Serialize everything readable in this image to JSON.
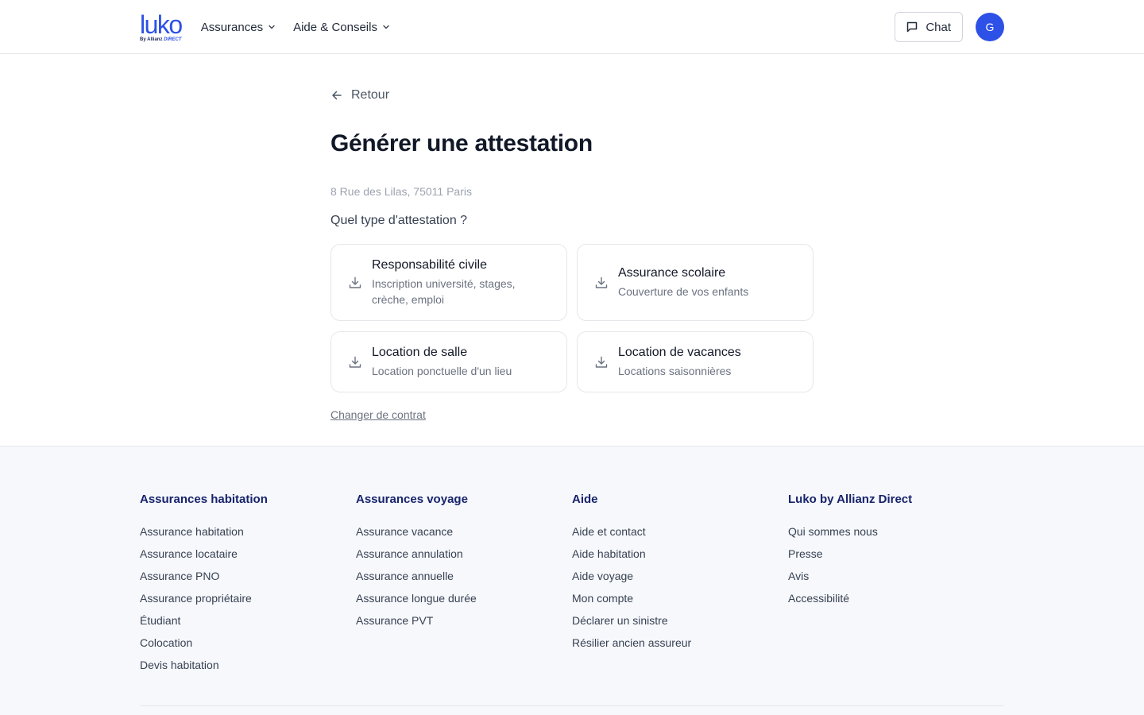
{
  "header": {
    "logo": {
      "word": "luko",
      "sub_prefix": "By Allianz",
      "sub_brand": "DIRECT"
    },
    "nav": [
      {
        "label": "Assurances"
      },
      {
        "label": "Aide & Conseils"
      }
    ],
    "chat_label": "Chat",
    "avatar_initial": "G"
  },
  "main": {
    "back_label": "Retour",
    "title": "Générer une attestation",
    "address": "8 Rue des Lilas, 75011 Paris",
    "question": "Quel type d'attestation ?",
    "options": [
      {
        "title": "Responsabilité civile",
        "desc": "Inscription université, stages, crèche, emploi"
      },
      {
        "title": "Assurance scolaire",
        "desc": "Couverture de vos enfants"
      },
      {
        "title": "Location de salle",
        "desc": "Location ponctuelle d'un lieu"
      },
      {
        "title": "Location de vacances",
        "desc": "Locations saisonnières"
      }
    ],
    "change_contract": "Changer de contrat"
  },
  "footer": {
    "columns": [
      {
        "title": "Assurances habitation",
        "links": [
          "Assurance habitation",
          "Assurance locataire",
          "Assurance PNO",
          "Assurance propriétaire",
          "Étudiant",
          "Colocation",
          "Devis habitation"
        ]
      },
      {
        "title": "Assurances voyage",
        "links": [
          "Assurance vacance",
          "Assurance annulation",
          "Assurance annuelle",
          "Assurance longue durée",
          "Assurance PVT"
        ]
      },
      {
        "title": "Aide",
        "links": [
          "Aide et contact",
          "Aide habitation",
          "Aide voyage",
          "Mon compte",
          "Déclarer un sinistre",
          "Résilier ancien assureur"
        ]
      },
      {
        "title": "Luko by Allianz Direct",
        "links": [
          "Qui sommes nous",
          "Presse",
          "Avis",
          "Accessibilité"
        ]
      }
    ]
  },
  "colors": {
    "brand": "#2d50e6",
    "footer_heading": "#17236b",
    "footer_bg": "#f6f8fc"
  },
  "icons": {
    "nav_chevron": "chevron-down-icon",
    "chat": "chat-bubble-icon",
    "back": "arrow-left-icon",
    "option": "download-icon"
  }
}
